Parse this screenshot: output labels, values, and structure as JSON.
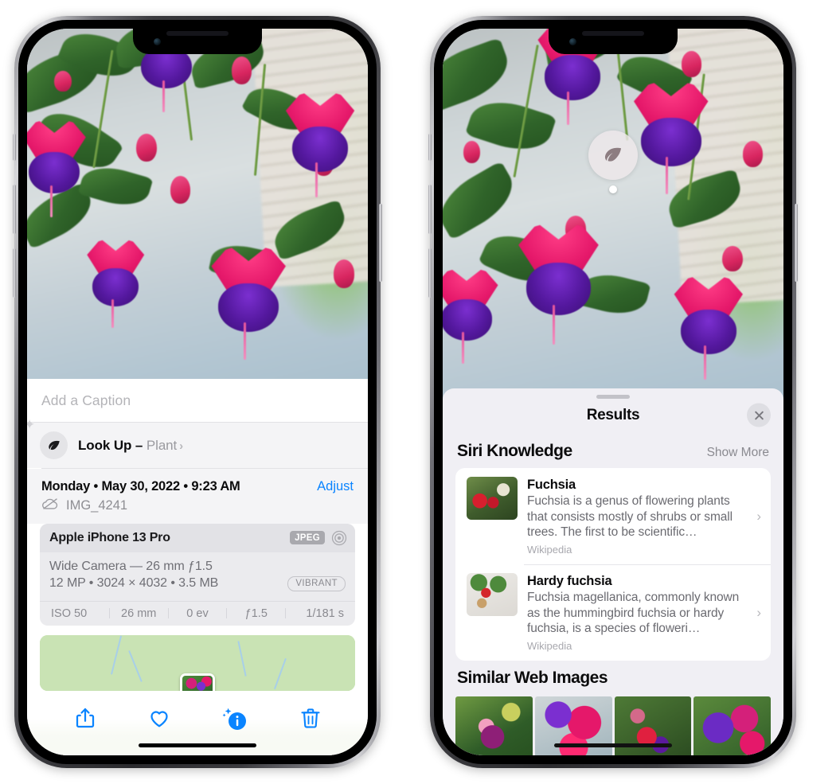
{
  "left_phone": {
    "caption_placeholder": "Add a Caption",
    "lookup": {
      "label": "Look Up – ",
      "subject": "Plant",
      "chevron": "›",
      "icon": "leaf-icon"
    },
    "date_line": "Monday • May 30, 2022 • 9:23 AM",
    "adjust_label": "Adjust",
    "file_name": "IMG_4241",
    "camera": {
      "model": "Apple iPhone 13 Pro",
      "format_badge": "JPEG",
      "lens_line": "Wide Camera — 26 mm ƒ1.5",
      "specs_line": "12 MP • 3024 × 4032 • 3.5 MB",
      "style_badge": "VIBRANT",
      "exif": [
        "ISO 50",
        "26 mm",
        "0 ev",
        "ƒ1.5",
        "1/181 s"
      ]
    },
    "toolbar": [
      {
        "name": "share-button",
        "icon": "share-icon"
      },
      {
        "name": "favorite-button",
        "icon": "heart-icon"
      },
      {
        "name": "info-button",
        "icon": "info-sparkle-icon"
      },
      {
        "name": "delete-button",
        "icon": "trash-icon"
      }
    ]
  },
  "right_phone": {
    "photo_badge_icon": "leaf-icon",
    "sheet": {
      "title": "Results",
      "close_icon": "close-icon",
      "sections": [
        {
          "title": "Siri Knowledge",
          "action_label": "Show More",
          "cards": [
            {
              "title": "Fuchsia",
              "description": "Fuchsia is a genus of flowering plants that consists mostly of shrubs or small trees. The first to be scientific…",
              "source": "Wikipedia",
              "chevron": "›"
            },
            {
              "title": "Hardy fuchsia",
              "description": "Fuchsia magellanica, commonly known as the hummingbird fuchsia or hardy fuchsia, is a species of floweri…",
              "source": "Wikipedia",
              "chevron": "›"
            }
          ]
        },
        {
          "title": "Similar Web Images",
          "thumbnails": [
            "web-image-1",
            "web-image-2",
            "web-image-3",
            "web-image-4"
          ]
        }
      ]
    }
  },
  "colors": {
    "accent_blue": "#0a84ff",
    "sheet_bg": "#f0eff4",
    "card_bg": "#ffffff",
    "panel_bg": "#f4f4f6",
    "secondary_text": "#8a8a90"
  }
}
